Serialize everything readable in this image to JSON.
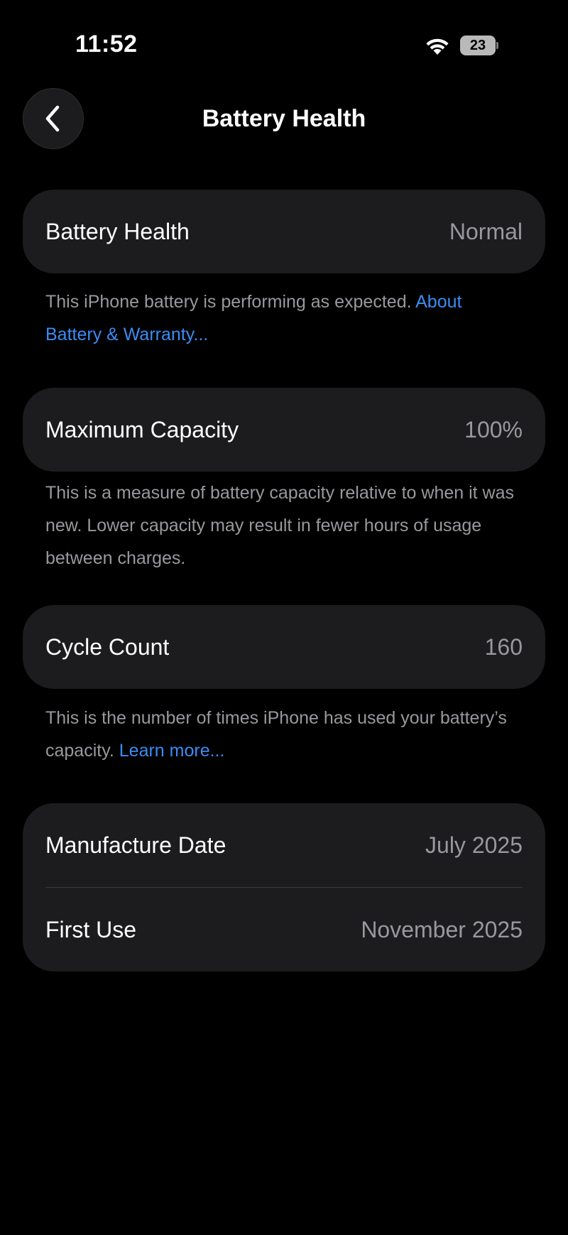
{
  "status_bar": {
    "time": "11:52",
    "battery_level": "23",
    "wifi_icon": "wifi-icon"
  },
  "nav": {
    "back_icon": "chevron-left-icon",
    "title": "Battery Health"
  },
  "health": {
    "label": "Battery Health",
    "value": "Normal",
    "footnote": "This iPhone battery is performing as expected.",
    "link": "About Battery & Warranty..."
  },
  "capacity": {
    "label": "Maximum Capacity",
    "value": "100%",
    "footnote": "This is a measure of battery capacity relative to when it was new. Lower capacity may result in fewer hours of usage between charges."
  },
  "cycle": {
    "label": "Cycle Count",
    "value": "160",
    "footnote": "This is the number of times iPhone has used your battery’s capacity.",
    "link": "Learn more..."
  },
  "dates": {
    "manufacture_label": "Manufacture Date",
    "manufacture_value": "July 2025",
    "first_use_label": "First Use",
    "first_use_value": "November 2025"
  },
  "colors": {
    "background": "#000000",
    "card": "#1c1c1e",
    "secondary_text": "#98989e",
    "link": "#3b8cf5"
  }
}
